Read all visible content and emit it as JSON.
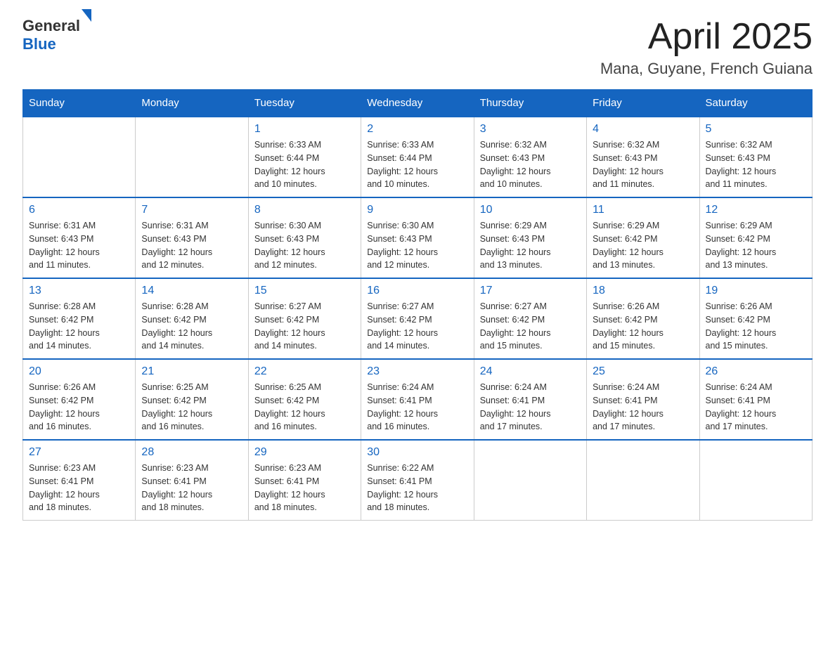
{
  "header": {
    "logo_general": "General",
    "logo_blue": "Blue",
    "title": "April 2025",
    "subtitle": "Mana, Guyane, French Guiana"
  },
  "days_of_week": [
    "Sunday",
    "Monday",
    "Tuesday",
    "Wednesday",
    "Thursday",
    "Friday",
    "Saturday"
  ],
  "weeks": [
    [
      {
        "num": "",
        "info": ""
      },
      {
        "num": "",
        "info": ""
      },
      {
        "num": "1",
        "info": "Sunrise: 6:33 AM\nSunset: 6:44 PM\nDaylight: 12 hours\nand 10 minutes."
      },
      {
        "num": "2",
        "info": "Sunrise: 6:33 AM\nSunset: 6:44 PM\nDaylight: 12 hours\nand 10 minutes."
      },
      {
        "num": "3",
        "info": "Sunrise: 6:32 AM\nSunset: 6:43 PM\nDaylight: 12 hours\nand 10 minutes."
      },
      {
        "num": "4",
        "info": "Sunrise: 6:32 AM\nSunset: 6:43 PM\nDaylight: 12 hours\nand 11 minutes."
      },
      {
        "num": "5",
        "info": "Sunrise: 6:32 AM\nSunset: 6:43 PM\nDaylight: 12 hours\nand 11 minutes."
      }
    ],
    [
      {
        "num": "6",
        "info": "Sunrise: 6:31 AM\nSunset: 6:43 PM\nDaylight: 12 hours\nand 11 minutes."
      },
      {
        "num": "7",
        "info": "Sunrise: 6:31 AM\nSunset: 6:43 PM\nDaylight: 12 hours\nand 12 minutes."
      },
      {
        "num": "8",
        "info": "Sunrise: 6:30 AM\nSunset: 6:43 PM\nDaylight: 12 hours\nand 12 minutes."
      },
      {
        "num": "9",
        "info": "Sunrise: 6:30 AM\nSunset: 6:43 PM\nDaylight: 12 hours\nand 12 minutes."
      },
      {
        "num": "10",
        "info": "Sunrise: 6:29 AM\nSunset: 6:43 PM\nDaylight: 12 hours\nand 13 minutes."
      },
      {
        "num": "11",
        "info": "Sunrise: 6:29 AM\nSunset: 6:42 PM\nDaylight: 12 hours\nand 13 minutes."
      },
      {
        "num": "12",
        "info": "Sunrise: 6:29 AM\nSunset: 6:42 PM\nDaylight: 12 hours\nand 13 minutes."
      }
    ],
    [
      {
        "num": "13",
        "info": "Sunrise: 6:28 AM\nSunset: 6:42 PM\nDaylight: 12 hours\nand 14 minutes."
      },
      {
        "num": "14",
        "info": "Sunrise: 6:28 AM\nSunset: 6:42 PM\nDaylight: 12 hours\nand 14 minutes."
      },
      {
        "num": "15",
        "info": "Sunrise: 6:27 AM\nSunset: 6:42 PM\nDaylight: 12 hours\nand 14 minutes."
      },
      {
        "num": "16",
        "info": "Sunrise: 6:27 AM\nSunset: 6:42 PM\nDaylight: 12 hours\nand 14 minutes."
      },
      {
        "num": "17",
        "info": "Sunrise: 6:27 AM\nSunset: 6:42 PM\nDaylight: 12 hours\nand 15 minutes."
      },
      {
        "num": "18",
        "info": "Sunrise: 6:26 AM\nSunset: 6:42 PM\nDaylight: 12 hours\nand 15 minutes."
      },
      {
        "num": "19",
        "info": "Sunrise: 6:26 AM\nSunset: 6:42 PM\nDaylight: 12 hours\nand 15 minutes."
      }
    ],
    [
      {
        "num": "20",
        "info": "Sunrise: 6:26 AM\nSunset: 6:42 PM\nDaylight: 12 hours\nand 16 minutes."
      },
      {
        "num": "21",
        "info": "Sunrise: 6:25 AM\nSunset: 6:42 PM\nDaylight: 12 hours\nand 16 minutes."
      },
      {
        "num": "22",
        "info": "Sunrise: 6:25 AM\nSunset: 6:42 PM\nDaylight: 12 hours\nand 16 minutes."
      },
      {
        "num": "23",
        "info": "Sunrise: 6:24 AM\nSunset: 6:41 PM\nDaylight: 12 hours\nand 16 minutes."
      },
      {
        "num": "24",
        "info": "Sunrise: 6:24 AM\nSunset: 6:41 PM\nDaylight: 12 hours\nand 17 minutes."
      },
      {
        "num": "25",
        "info": "Sunrise: 6:24 AM\nSunset: 6:41 PM\nDaylight: 12 hours\nand 17 minutes."
      },
      {
        "num": "26",
        "info": "Sunrise: 6:24 AM\nSunset: 6:41 PM\nDaylight: 12 hours\nand 17 minutes."
      }
    ],
    [
      {
        "num": "27",
        "info": "Sunrise: 6:23 AM\nSunset: 6:41 PM\nDaylight: 12 hours\nand 18 minutes."
      },
      {
        "num": "28",
        "info": "Sunrise: 6:23 AM\nSunset: 6:41 PM\nDaylight: 12 hours\nand 18 minutes."
      },
      {
        "num": "29",
        "info": "Sunrise: 6:23 AM\nSunset: 6:41 PM\nDaylight: 12 hours\nand 18 minutes."
      },
      {
        "num": "30",
        "info": "Sunrise: 6:22 AM\nSunset: 6:41 PM\nDaylight: 12 hours\nand 18 minutes."
      },
      {
        "num": "",
        "info": ""
      },
      {
        "num": "",
        "info": ""
      },
      {
        "num": "",
        "info": ""
      }
    ]
  ]
}
